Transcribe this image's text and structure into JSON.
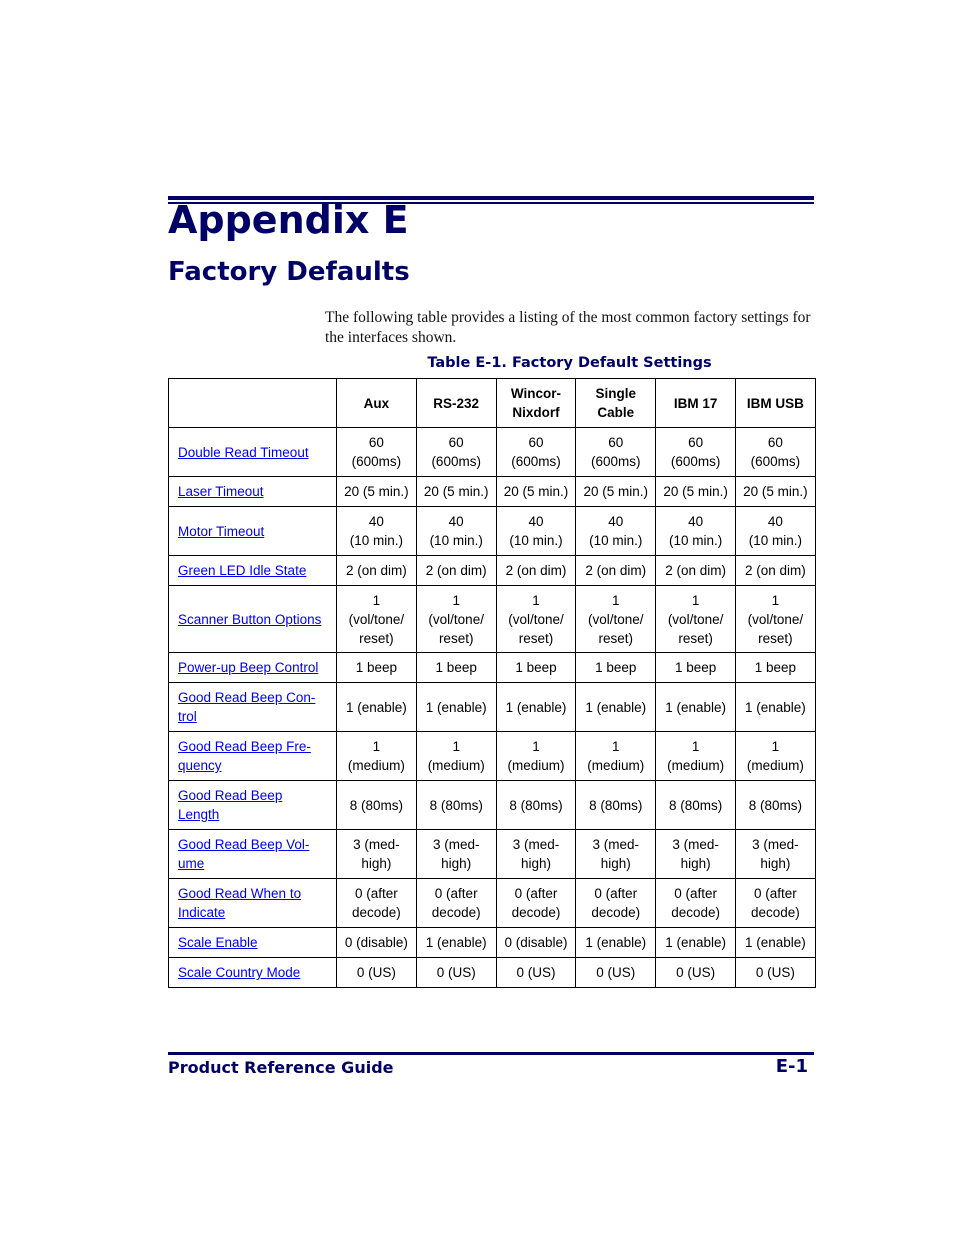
{
  "header": {
    "appendix_title": "Appendix E",
    "section_title": "Factory Defaults"
  },
  "intro": "The following table provides a listing of the most common factory settings for the interfaces shown.",
  "table": {
    "caption": "Table E-1. Factory Default Settings",
    "columns": [
      "",
      "Aux",
      "RS-232",
      "Wincor-\nNixdorf",
      "Single\nCable",
      "IBM 17",
      "IBM USB"
    ],
    "rows": [
      {
        "label": "Double Read Timeout",
        "values": [
          "60\n(600ms)",
          "60\n(600ms)",
          "60\n(600ms)",
          "60\n(600ms)",
          "60\n(600ms)",
          "60\n(600ms)"
        ]
      },
      {
        "label": "Laser Timeout",
        "values": [
          "20 (5 min.)",
          "20 (5 min.)",
          "20 (5 min.)",
          "20 (5 min.)",
          "20 (5 min.)",
          "20 (5 min.)"
        ]
      },
      {
        "label": "Motor Timeout",
        "values": [
          "40\n(10 min.)",
          "40\n(10 min.)",
          "40\n(10 min.)",
          "40\n(10 min.)",
          "40\n(10 min.)",
          "40\n(10 min.)"
        ]
      },
      {
        "label": "Green LED Idle State",
        "values": [
          "2 (on dim)",
          "2 (on dim)",
          "2 (on dim)",
          "2 (on dim)",
          "2 (on dim)",
          "2 (on dim)"
        ]
      },
      {
        "label": "Scanner Button Options",
        "values": [
          "1\n(vol/tone/\nreset)",
          "1\n(vol/tone/\nreset)",
          "1\n(vol/tone/\nreset)",
          "1\n(vol/tone/\nreset)",
          "1\n(vol/tone/\nreset)",
          "1\n(vol/tone/\nreset)"
        ]
      },
      {
        "label": "Power-up Beep Control",
        "values": [
          "1 beep",
          "1 beep",
          "1 beep",
          "1 beep",
          "1 beep",
          "1 beep"
        ]
      },
      {
        "label": "Good Read Beep Con-\ntrol",
        "values": [
          "1 (enable)",
          "1 (enable)",
          "1 (enable)",
          "1 (enable)",
          "1 (enable)",
          "1 (enable)"
        ]
      },
      {
        "label": "Good Read Beep Fre-\nquency",
        "values": [
          "1\n(medium)",
          "1\n(medium)",
          "1\n(medium)",
          "1\n(medium)",
          "1\n(medium)",
          "1\n(medium)"
        ]
      },
      {
        "label": "Good Read Beep \nLength",
        "values": [
          "8 (80ms)",
          "8 (80ms)",
          "8 (80ms)",
          "8 (80ms)",
          "8 (80ms)",
          "8 (80ms)"
        ]
      },
      {
        "label": "Good Read Beep Vol-\nume",
        "values": [
          "3 (med-\nhigh)",
          "3 (med-\nhigh)",
          "3 (med-\nhigh)",
          "3 (med-\nhigh)",
          "3 (med-\nhigh)",
          "3 (med-\nhigh)"
        ]
      },
      {
        "label": "Good Read When to \nIndicate",
        "values": [
          "0 (after\ndecode)",
          "0 (after\ndecode)",
          "0 (after\ndecode)",
          "0 (after\ndecode)",
          "0 (after\ndecode)",
          "0 (after\ndecode)"
        ]
      },
      {
        "label": "Scale Enable",
        "values": [
          "0 (disable)",
          "1 (enable)",
          "0 (disable)",
          "1 (enable)",
          "1 (enable)",
          "1 (enable)"
        ]
      },
      {
        "label": "Scale Country Mode",
        "values": [
          "0 (US)",
          "0 (US)",
          "0 (US)",
          "0 (US)",
          "0 (US)",
          "0 (US)"
        ]
      }
    ]
  },
  "footer": {
    "title": "Product Reference Guide",
    "page_number": "E-1"
  },
  "colors": {
    "heading": "#000066",
    "link": "#0000ee",
    "text": "#000000"
  }
}
